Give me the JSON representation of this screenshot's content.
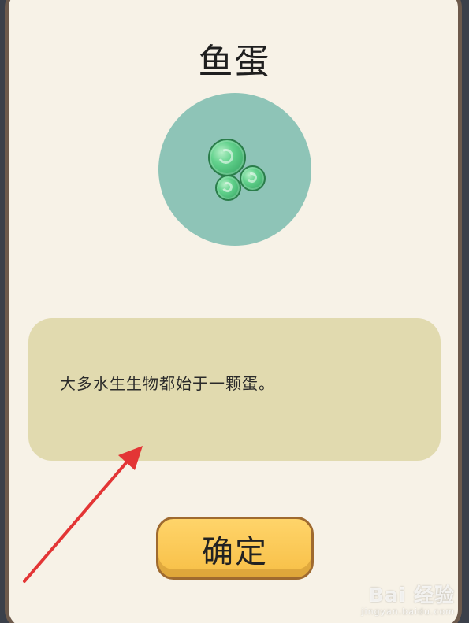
{
  "dialog": {
    "title": "鱼蛋",
    "description": "大多水生生物都始于一颗蛋。",
    "confirm_label": "确定"
  },
  "icons": {
    "item_image": "fish-eggs-icon",
    "annotation": "red-arrow-annotation"
  },
  "watermark": {
    "brand": "Bai  经验",
    "url": "jingyan.baidu.com"
  },
  "colors": {
    "panel": "#f7f2e7",
    "description_box": "#e1daaf",
    "avatar_circle": "#8ec4b7",
    "button": "#f7bf46",
    "arrow": "#e33535"
  }
}
